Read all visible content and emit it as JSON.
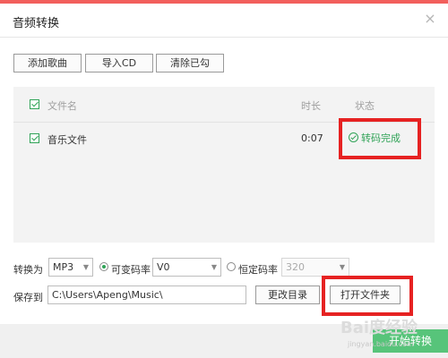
{
  "window": {
    "title": "音频转换",
    "close_glyph": "×"
  },
  "toolbar": {
    "add_label": "添加歌曲",
    "import_label": "导入CD",
    "clear_label": "清除已勾"
  },
  "list": {
    "columns": {
      "name": "文件名",
      "duration": "时长",
      "status": "状态"
    },
    "rows": [
      {
        "name": "音乐文件",
        "duration": "0:07",
        "status": "转码完成",
        "checked": true
      }
    ]
  },
  "convert": {
    "label": "转换为",
    "format": "MP3",
    "vbr_label": "可变码率",
    "vbr_value": "V0",
    "cbr_label": "恒定码率",
    "cbr_value": "320",
    "mode": "vbr"
  },
  "save": {
    "label": "保存到",
    "path": "C:\\Users\\Apeng\\Music\\",
    "change_dir_label": "更改目录",
    "open_folder_label": "打开文件夹"
  },
  "footer": {
    "start_label": "开始转换",
    "watermark": "Bai度经验",
    "watermark_sub": "jingyan.baidu.com"
  },
  "colors": {
    "accent_green": "#30a357",
    "highlight_red": "#e62222",
    "top_strip": "#f25f5c"
  }
}
